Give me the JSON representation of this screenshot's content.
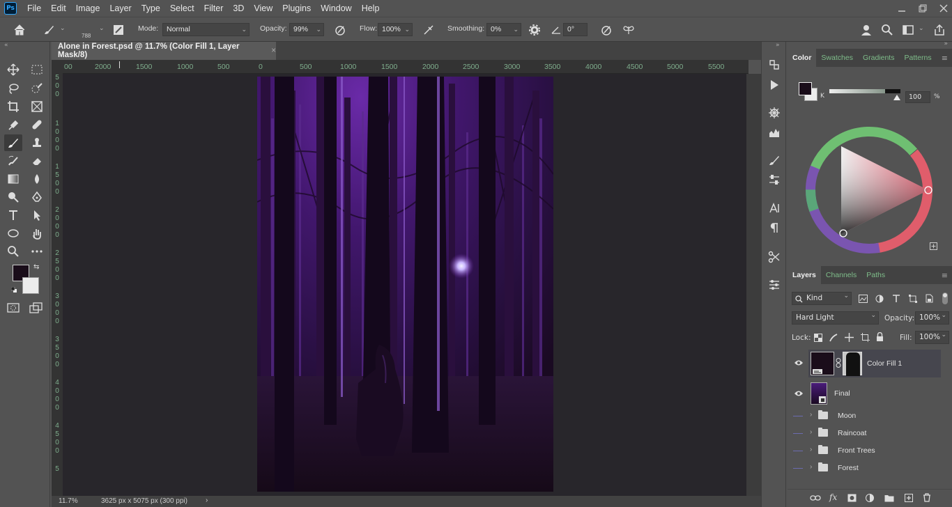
{
  "menubar": {
    "logo": "Ps",
    "items": [
      "File",
      "Edit",
      "Image",
      "Layer",
      "Type",
      "Select",
      "Filter",
      "3D",
      "View",
      "Plugins",
      "Window",
      "Help"
    ]
  },
  "options": {
    "brush_size": "788",
    "mode_label": "Mode:",
    "mode_value": "Normal",
    "opacity_label": "Opacity:",
    "opacity_value": "99%",
    "flow_label": "Flow:",
    "flow_value": "100%",
    "smoothing_label": "Smoothing:",
    "smoothing_value": "0%",
    "angle_value": "0°"
  },
  "document": {
    "tab_title": "Alone in Forest.psd @ 11.7% (Color Fill 1, Layer Mask/8)",
    "tab_close": "×",
    "ruler_h": [
      "00",
      "2000",
      "1500",
      "1000",
      "500",
      "0",
      "500",
      "1000",
      "1500",
      "2000",
      "2500",
      "3000",
      "3500",
      "4000",
      "4500",
      "5000",
      "5500"
    ],
    "ruler_v": [
      "5",
      "0",
      "0",
      "1",
      "0",
      "0",
      "0",
      "1",
      "5",
      "0",
      "0",
      "2",
      "0",
      "0",
      "0",
      "2",
      "5",
      "0",
      "0",
      "3",
      "0",
      "0",
      "0",
      "3",
      "5",
      "0",
      "0",
      "4",
      "0",
      "0",
      "0",
      "4",
      "5",
      "0",
      "0",
      "5"
    ],
    "zoom": "11.7%",
    "doc_info": "3625 px x 5075 px (300 ppi)",
    "status_arrow": "›"
  },
  "color_panel": {
    "tabs": [
      "Color",
      "Swatches",
      "Gradients",
      "Patterns"
    ],
    "channel_label": "K",
    "channel_value": "100",
    "channel_unit": "%",
    "foreground_color": "#1a0d1a",
    "background_color": "#ececec"
  },
  "layers_panel": {
    "tabs": [
      "Layers",
      "Channels",
      "Paths"
    ],
    "filter_kind": "Kind",
    "blend_mode": "Hard Light",
    "opacity_label": "Opacity:",
    "opacity_value": "100%",
    "lock_label": "Lock:",
    "fill_label": "Fill:",
    "fill_value": "100%",
    "layers": [
      {
        "name": "Color Fill 1",
        "visible": true,
        "selected": true
      },
      {
        "name": "Final",
        "visible": true,
        "selected": false
      }
    ],
    "groups": [
      "Moon",
      "Raincoat",
      "Front Trees",
      "Forest"
    ],
    "footer_fx": "fx"
  }
}
